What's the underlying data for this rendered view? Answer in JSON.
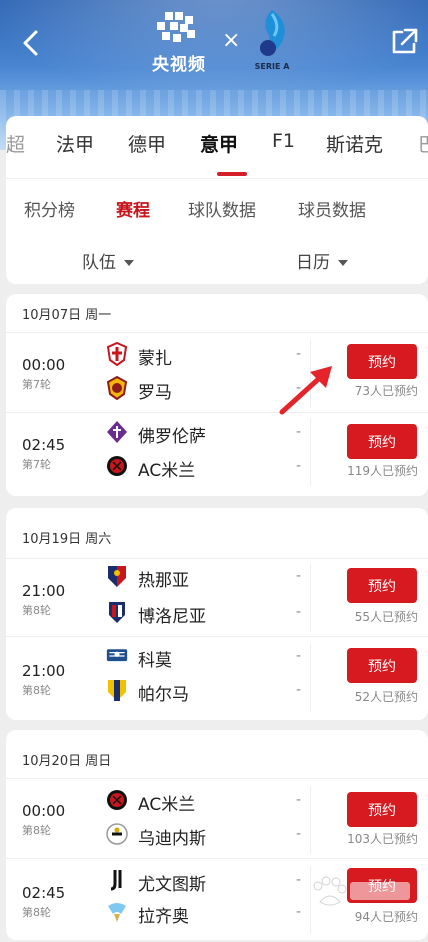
{
  "header": {
    "logo_text": "央视频",
    "times": "×",
    "serie_label": "SERIE A"
  },
  "league_tabs": [
    {
      "label": "超"
    },
    {
      "label": "法甲"
    },
    {
      "label": "德甲"
    },
    {
      "label": "意甲",
      "active": true
    },
    {
      "label": "F1"
    },
    {
      "label": "斯诺克"
    },
    {
      "label": "巴"
    }
  ],
  "sub_tabs": [
    {
      "label": "积分榜"
    },
    {
      "label": "赛程",
      "active": true
    },
    {
      "label": "球队数据"
    },
    {
      "label": "球员数据"
    }
  ],
  "filters": {
    "team": "队伍",
    "calendar": "日历"
  },
  "days": [
    {
      "date": "10月07日 周一",
      "matches": [
        {
          "time": "00:00",
          "round": "第7轮",
          "home": "蒙扎",
          "away": "罗马",
          "home_score": "-",
          "away_score": "-",
          "btn": "预约",
          "booked": "73人已预约"
        },
        {
          "time": "02:45",
          "round": "第7轮",
          "home": "佛罗伦萨",
          "away": "AC米兰",
          "home_score": "-",
          "away_score": "-",
          "btn": "预约",
          "booked": "119人已预约"
        }
      ]
    },
    {
      "date": "10月19日 周六",
      "matches": [
        {
          "time": "21:00",
          "round": "第8轮",
          "home": "热那亚",
          "away": "博洛尼亚",
          "home_score": "-",
          "away_score": "-",
          "btn": "预约",
          "booked": "55人已预约"
        },
        {
          "time": "21:00",
          "round": "第8轮",
          "home": "科莫",
          "away": "帕尔马",
          "home_score": "-",
          "away_score": "-",
          "btn": "预约",
          "booked": "52人已预约"
        }
      ]
    },
    {
      "date": "10月20日 周日",
      "matches": [
        {
          "time": "00:00",
          "round": "第8轮",
          "home": "AC米兰",
          "away": "乌迪内斯",
          "home_score": "-",
          "away_score": "-",
          "btn": "预约",
          "booked": "103人已预约"
        },
        {
          "time": "02:45",
          "round": "第8轮",
          "home": "尤文图斯",
          "away": "拉齐奥",
          "home_score": "-",
          "away_score": "-",
          "btn": "预约",
          "booked": "94人已预约"
        }
      ]
    }
  ],
  "colors": {
    "accent": "#d71920",
    "tab_active": "#c8161d"
  },
  "icons": [
    "back-arrow-icon",
    "share-icon",
    "cctv-logo",
    "serie-a-logo",
    "caret-down-icon",
    "team-crest-icon",
    "red-arrow-annotation",
    "baidu-watermark"
  ]
}
